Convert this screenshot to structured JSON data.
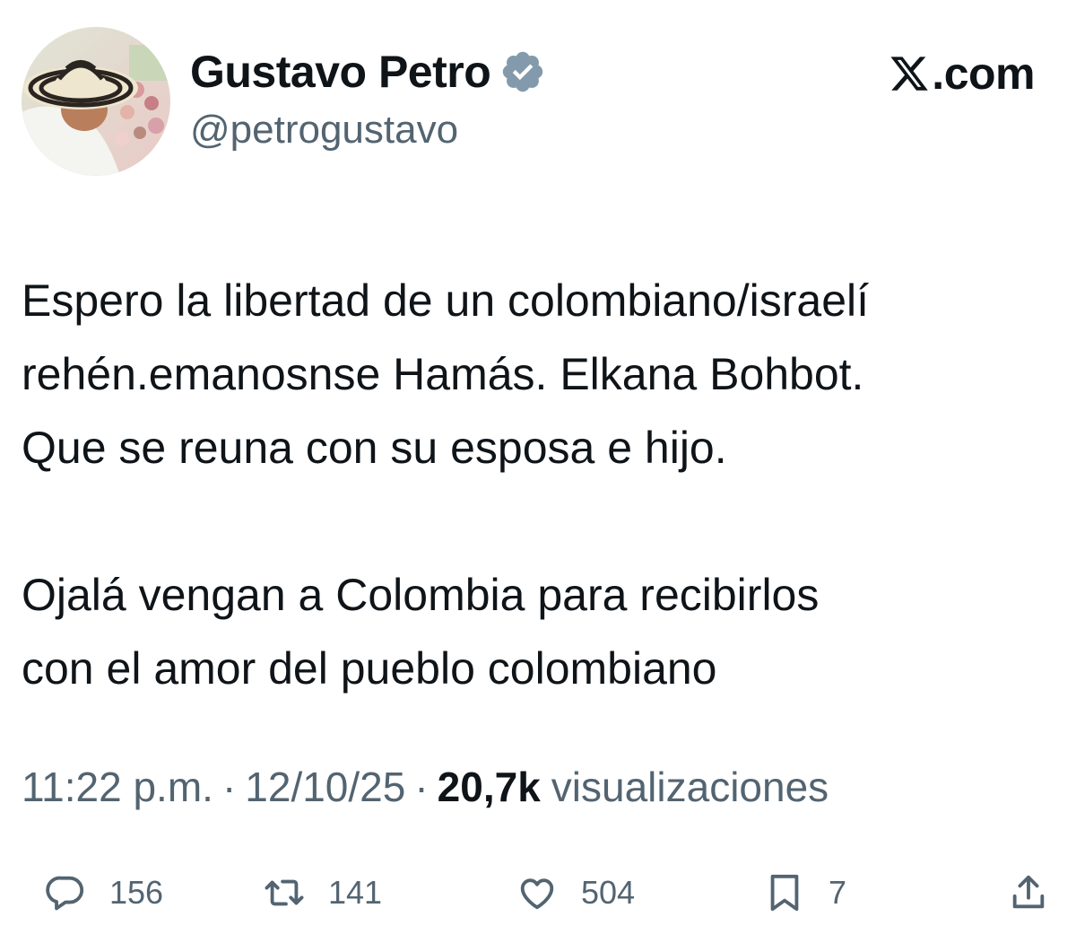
{
  "header": {
    "display_name": "Gustavo Petro",
    "handle": "@petrogustavo",
    "source": ".com",
    "verified_icon": "verified-badge-icon",
    "source_icon": "x-logo-icon"
  },
  "tweet": {
    "paragraphs": [
      [
        "Espero la libertad de un colombiano/israelí",
        "rehén.emanosnse Hamás. Elkana Bohbot.",
        "Que se reuna con su esposa e hijo."
      ],
      [
        "Ojalá vengan a Colombia para recibirlos",
        "con el amor del pueblo colombiano"
      ]
    ]
  },
  "meta": {
    "time": "11:22 p.m.",
    "separator": "·",
    "date": "12/10/25",
    "views_count": "20,7k",
    "views_label": "visualizaciones"
  },
  "actions": {
    "reply_count": "156",
    "retweet_count": "141",
    "like_count": "504",
    "bookmark_count": "7"
  },
  "colors": {
    "text_primary": "#0f1419",
    "text_secondary": "#536471",
    "badge": "#829aab"
  }
}
